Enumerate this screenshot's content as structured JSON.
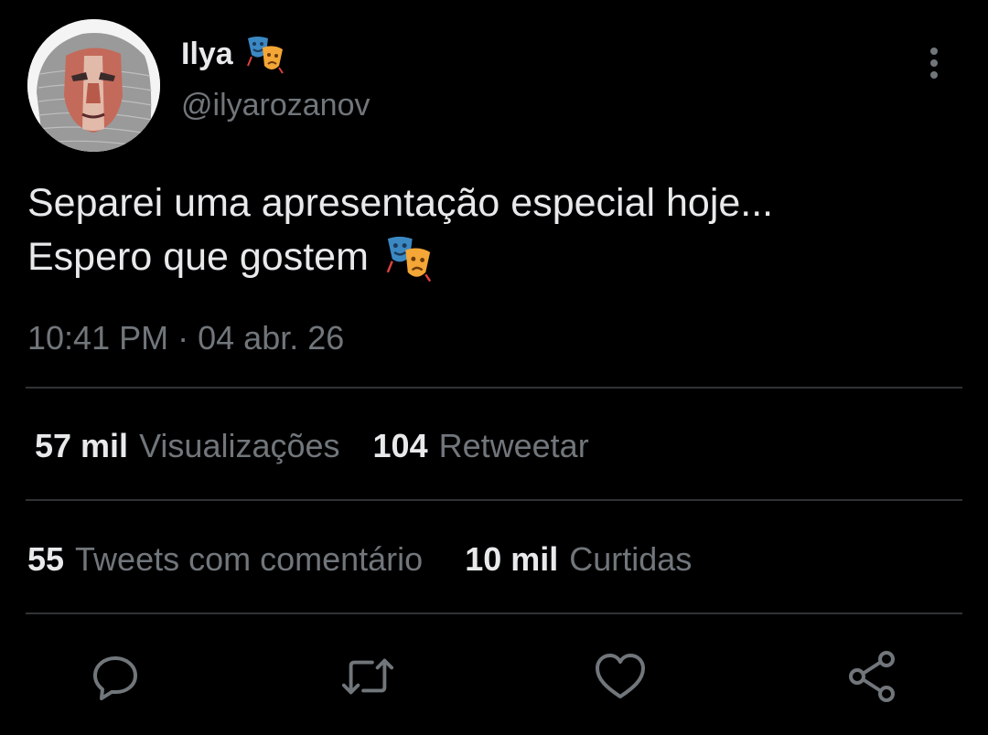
{
  "author": {
    "display_name": "Ilya",
    "name_emoji": "performing-arts-emoji",
    "handle": "@ilyarozanov",
    "avatar": "avatar-face-chainmail"
  },
  "tweet": {
    "line1": "Separei uma apresentação especial hoje...",
    "line2": "Espero que gostem",
    "trailing_emoji": "performing-arts-emoji"
  },
  "timestamp": {
    "time": "10:41 PM",
    "separator": "·",
    "date": "04 abr. 26"
  },
  "stats": {
    "views": {
      "value": "57 mil",
      "label": "Visualizações"
    },
    "retweets": {
      "value": "104",
      "label": "Retweetar"
    },
    "quotes": {
      "value": "55",
      "label": "Tweets com comentário"
    },
    "likes": {
      "value": "10 mil",
      "label": "Curtidas"
    }
  },
  "actions": [
    "reply-icon",
    "retweet-icon",
    "like-icon",
    "share-icon"
  ],
  "colors": {
    "background": "#000000",
    "primary_text": "#e7e9ea",
    "secondary_text": "#71767b",
    "divider": "#2f3336"
  }
}
